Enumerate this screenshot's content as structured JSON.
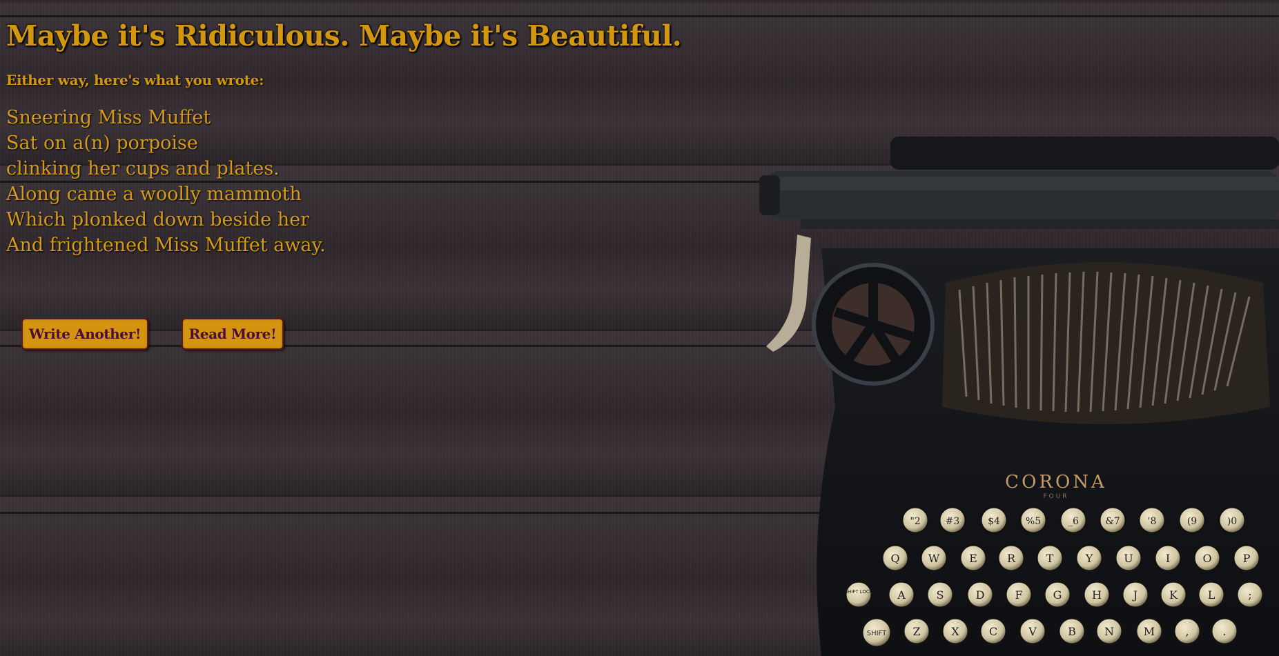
{
  "header": {
    "title": "Maybe it's Ridiculous. Maybe it's Beautiful.",
    "subtitle": "Either way, here's what you wrote:"
  },
  "poem": {
    "lines": [
      "Sneering Miss Muffet",
      "Sat on a(n) porpoise",
      "clinking her cups and plates.",
      "Along came a woolly mammoth",
      "Which plonked down beside her",
      "And frightened Miss Muffet away."
    ]
  },
  "buttons": {
    "write_another": "Write Another!",
    "read_more": "Read More!"
  },
  "typewriter": {
    "brand": "CORONA",
    "model": "FOUR",
    "row1": [
      "\"2",
      "#3",
      "$4",
      "%5",
      "_6",
      "&7",
      "'8",
      "(9",
      ")0"
    ],
    "row2": [
      "Q",
      "W",
      "E",
      "R",
      "T",
      "Y",
      "U",
      "I",
      "O",
      "P"
    ],
    "row3": [
      "A",
      "S",
      "D",
      "F",
      "G",
      "H",
      "J",
      "K",
      "L",
      ";"
    ],
    "row4": [
      "Z",
      "X",
      "C",
      "V",
      "B",
      "N",
      "M",
      ",",
      "."
    ],
    "shift_lock": "SHIFT LOCK",
    "shift": "SHIFT"
  },
  "colors": {
    "accent": "#d3970f",
    "button_text": "#4b0d39",
    "button_border": "#5d1b1b",
    "wood": "#2f2a2e"
  }
}
